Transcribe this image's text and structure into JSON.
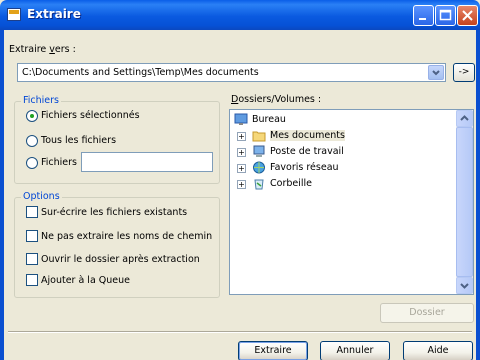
{
  "window": {
    "title": "Extraire"
  },
  "extract_to": {
    "label_pre": "Extraire ",
    "label_ul": "v",
    "label_post": "ers :",
    "path": "C:\\Documents and Settings\\Temp\\Mes documents",
    "arrow_label": "->"
  },
  "files_group": {
    "title": "Fichiers",
    "options": [
      "Fichiers sélectionnés",
      "Tous les fichiers",
      "Fichiers"
    ],
    "selected": "Fichiers sélectionnés",
    "filter_value": ""
  },
  "options_group": {
    "title": "Options",
    "items": [
      {
        "label": "Sur-écrire les fichiers existants",
        "checked": false
      },
      {
        "label": "Ne pas extraire les noms de chemin",
        "checked": false
      },
      {
        "label": "Ouvrir le dossier après extraction",
        "checked": false
      },
      {
        "label": "Ajouter à la Queue",
        "checked": false
      }
    ]
  },
  "folders": {
    "label_ul": "D",
    "label_post": "ossiers/Volumes :",
    "items": [
      {
        "label": "Bureau",
        "icon": "desktop-icon"
      },
      {
        "label": "Mes documents",
        "icon": "folder-icon"
      },
      {
        "label": "Poste de travail",
        "icon": "computer-icon"
      },
      {
        "label": "Favoris réseau",
        "icon": "network-icon"
      },
      {
        "label": "Corbeille",
        "icon": "recycle-bin-icon"
      }
    ]
  },
  "buttons": {
    "dossier": "Dossier",
    "extraire": "Extraire",
    "annuler": "Annuler",
    "aide": "Aide"
  }
}
